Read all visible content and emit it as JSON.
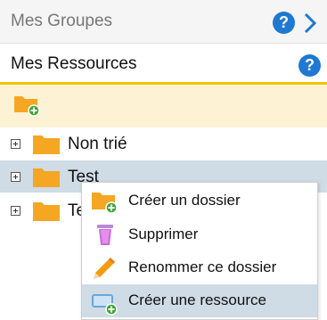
{
  "groups_header": {
    "title": "Mes Groupes"
  },
  "resources_header": {
    "title": "Mes Ressources"
  },
  "help_label": "?",
  "toolbar": {
    "add_folder_icon": "add-folder-icon"
  },
  "tree": [
    {
      "label": "Non trié",
      "selected": false
    },
    {
      "label": "Test",
      "selected": true
    },
    {
      "label": "Te",
      "selected": false
    }
  ],
  "context_menu": [
    {
      "label": "Créer un dossier",
      "icon": "add-folder-icon"
    },
    {
      "label": "Supprimer",
      "icon": "trash-icon"
    },
    {
      "label": "Renommer ce dossier",
      "icon": "pencil-icon"
    },
    {
      "label": "Créer une ressource",
      "icon": "add-resource-icon",
      "hovered": true
    }
  ],
  "colors": {
    "accent": "#f2c200",
    "help_blue": "#1f78d1",
    "folder": "#f5a623",
    "plus_green": "#3aa832",
    "selection": "#cfdbe5"
  }
}
